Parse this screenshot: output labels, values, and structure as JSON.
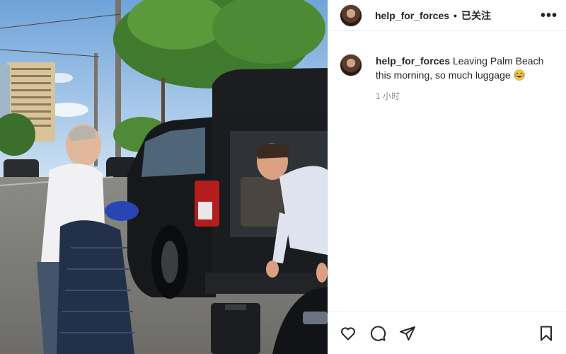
{
  "post_header": {
    "username": "help_for_forces",
    "separator": "•",
    "follow_status": "已关注",
    "more_icon": "more-horizontal-icon"
  },
  "caption": {
    "username": "help_for_forces",
    "text": "Leaving Palm Beach this morning, so much luggage",
    "emoji": "laughing-tears-emoji",
    "timestamp": "1 小时"
  },
  "actions": {
    "like_icon": "heart-icon",
    "comment_icon": "comment-icon",
    "share_icon": "send-icon",
    "save_icon": "bookmark-icon"
  },
  "photo": {
    "description_icon": "post-photo"
  }
}
